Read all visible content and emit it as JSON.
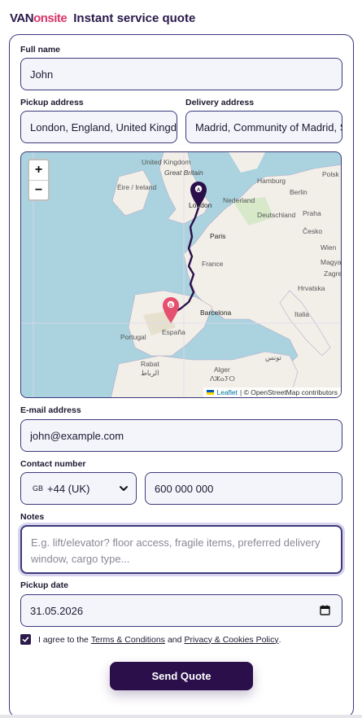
{
  "header": {
    "logo_van": "VAN",
    "logo_onsite": "onsite",
    "title": "Instant service quote"
  },
  "form": {
    "full_name": {
      "label": "Full name",
      "value": "John"
    },
    "pickup": {
      "label": "Pickup address",
      "value": "London, England, United Kingdom"
    },
    "delivery": {
      "label": "Delivery address",
      "value": "Madrid, Community of Madrid, Spain"
    },
    "email": {
      "label": "E-mail address",
      "value": "john@example.com"
    },
    "contact": {
      "label": "Contact number",
      "country_code": "GB",
      "dial": "+44 (UK)",
      "value": "600 000 000"
    },
    "notes": {
      "label": "Notes",
      "placeholder": "E.g. lift/elevator? floor access, fragile items, preferred delivery window, cargo type..."
    },
    "pickup_date": {
      "label": "Pickup date",
      "value": "31.05.2026"
    },
    "agree": {
      "prefix": "I agree to the",
      "terms": "Terms & Conditions",
      "and": "and",
      "privacy": "Privacy & Cookies Policy",
      "suffix": "."
    },
    "submit": "Send Quote"
  },
  "map": {
    "zoom_in": "+",
    "zoom_out": "−",
    "marker_a": "A",
    "marker_b": "B",
    "attribution_leaflet": "Leaflet",
    "attribution_osm": "| © OpenStreetMap contributors",
    "labels": {
      "uk": "United Kingdom",
      "gb": "Great Britain",
      "ireland": "Éire / Ireland",
      "london": "London",
      "hamburg": "Hamburg",
      "berlin": "Berlin",
      "nederland": "Nederland",
      "deutschland": "Deutschland",
      "paris": "Paris",
      "cesko": "Česko",
      "wien": "Wien",
      "france": "France",
      "barcelona": "Barcelona",
      "italia": "Italia",
      "hrvatska": "Hrvatska",
      "zagreb": "Zagreb",
      "portugal": "Portugal",
      "espana": "España",
      "rabat": "Rabat",
      "rabat_ar": "الرباط",
      "alger": "Alger",
      "alger_ar": "ⴷⵣⴰⵢⵔ",
      "tunis": "تونس",
      "polska": "Polsk",
      "praha": "Praha",
      "magya": "Magya"
    }
  },
  "colors": {
    "accent": "#2a0f4a",
    "brand_pink": "#d8366a",
    "border": "#3c3a7a",
    "marker_b": "#e5506e"
  }
}
